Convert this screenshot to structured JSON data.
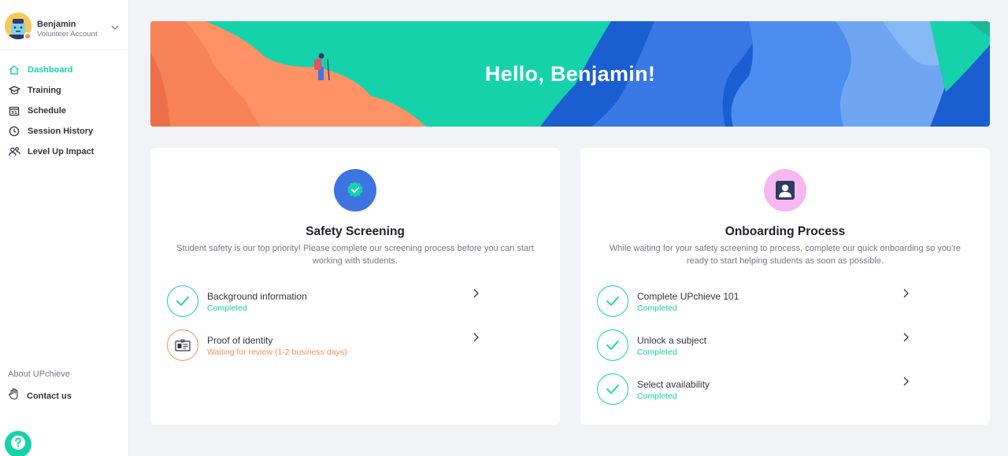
{
  "colors": {
    "accent": "#16d2aa",
    "warning": "#f58f5c",
    "blue": "#3e74e1",
    "pink": "#f6b8f0",
    "text": "#343440",
    "muted": "#77778b"
  },
  "profile": {
    "name": "Benjamin",
    "role": "Volunteer Account",
    "avatar_icon": "robot-avatar",
    "status": "pending"
  },
  "sidebar": {
    "items": [
      {
        "label": "Dashboard",
        "icon": "home-icon",
        "active": true
      },
      {
        "label": "Training",
        "icon": "graduation-cap-icon",
        "active": false
      },
      {
        "label": "Schedule",
        "icon": "calendar-icon",
        "active": false
      },
      {
        "label": "Session History",
        "icon": "clock-icon",
        "active": false
      },
      {
        "label": "Level Up Impact",
        "icon": "people-icon",
        "active": false
      }
    ],
    "about": "About UPchieve",
    "contact": "Contact us"
  },
  "banner": {
    "title": "Hello, Benjamin!"
  },
  "safety": {
    "title": "Safety Screening",
    "description": "Student safety is our top priority! Please complete our screening process before you can start working with students.",
    "steps": [
      {
        "title": "Background information",
        "status": "Completed",
        "state": "completed"
      },
      {
        "title": "Proof of identity",
        "status": "Waiting for review (1-2 business days)",
        "state": "pending"
      }
    ]
  },
  "onboarding": {
    "title": "Onboarding Process",
    "description": "While waiting for your safety screening to process, complete our quick onboarding so you're ready to start helping students as soon as possible.",
    "steps": [
      {
        "title": "Complete UPchieve 101",
        "status": "Completed",
        "state": "completed"
      },
      {
        "title": "Unlock a subject",
        "status": "Completed",
        "state": "completed"
      },
      {
        "title": "Select availability",
        "status": "Completed",
        "state": "completed"
      }
    ]
  }
}
